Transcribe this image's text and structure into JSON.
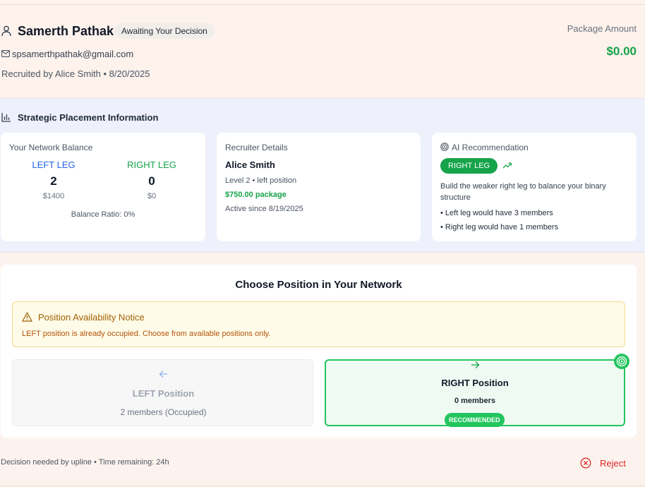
{
  "candidate": {
    "name": "Samerth Pathak",
    "status": "Awaiting Your Decision",
    "email": "spsamerthpathak@gmail.com",
    "recruited_text": "Recruited by Alice Smith • 8/20/2025",
    "package_label": "Package Amount",
    "package_amount": "$0.00"
  },
  "strategic": {
    "title": "Strategic Placement Information",
    "network_balance": {
      "label": "Your Network Balance",
      "left": {
        "name": "LEFT LEG",
        "count": "2",
        "amount": "$1400"
      },
      "right": {
        "name": "RIGHT LEG",
        "count": "0",
        "amount": "$0"
      },
      "ratio": "Balance Ratio: 0%"
    },
    "recruiter": {
      "label": "Recruiter Details",
      "name": "Alice Smith",
      "level": "Level 2 • left position",
      "package": "$750.00 package",
      "active": "Active since 8/19/2025"
    },
    "ai": {
      "label": "AI Recommendation",
      "badge": "RIGHT LEG",
      "description": "Build the weaker right leg to balance your binary structure",
      "bullets": [
        "• Left leg would have 3 members",
        "• Right leg would have 1 members"
      ]
    }
  },
  "choose": {
    "title": "Choose Position in Your Network",
    "notice_title": "Position Availability Notice",
    "notice_text": "LEFT position is already occupied. Choose from available positions only.",
    "left": {
      "title": "LEFT Position",
      "subtitle": "2 members (Occupied)"
    },
    "right": {
      "title": "RIGHT Position",
      "subtitle": "0 members",
      "badge": "RECOMMENDED"
    }
  },
  "footer": {
    "decision_text": "Decision needed by upline • Time remaining: 24h",
    "reject_label": "Reject"
  },
  "colors": {
    "green": "#16a34a",
    "blue": "#2563eb",
    "red": "#dc2626",
    "amber": "#a16207"
  },
  "icons": [
    "user-icon",
    "mail-icon",
    "bar-chart-icon",
    "target-icon",
    "trending-up-icon",
    "warning-icon",
    "arrow-left-icon",
    "arrow-right-icon",
    "x-circle-icon"
  ]
}
